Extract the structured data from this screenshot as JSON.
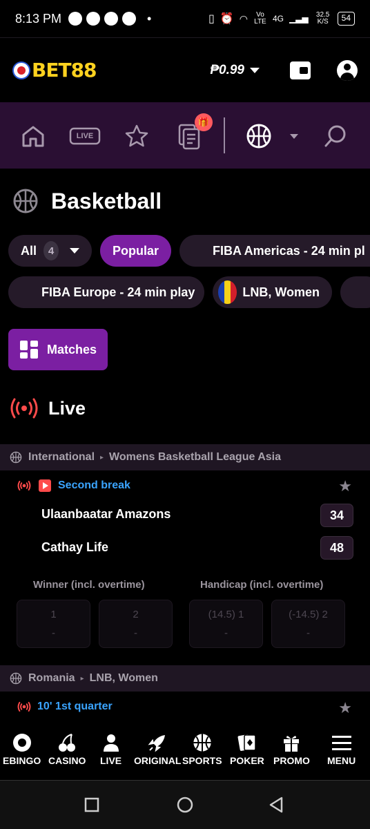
{
  "status_bar": {
    "time": "8:13 PM",
    "network": "Vo LTE",
    "signal": "4G",
    "speed": "32.5 K/S",
    "battery": "54"
  },
  "header": {
    "logo_text": "BET88",
    "balance": "₱0.99"
  },
  "nav": {
    "live_label": "LIVE"
  },
  "page_title": "Basketball",
  "filters": {
    "all_label": "All",
    "all_count": "4",
    "popular_label": "Popular",
    "fiba_americas": "FIBA Americas - 24 min pl",
    "fiba_europe": "FIBA Europe - 24 min play",
    "lnb_women": "LNB, Women"
  },
  "matches_button": "Matches",
  "live_heading": "Live",
  "events": [
    {
      "country": "International",
      "league": "Womens Basketball League Asia",
      "status": "Second break",
      "home_team": "Ulaanbaatar Amazons",
      "away_team": "Cathay Life",
      "home_score": "34",
      "away_score": "48",
      "markets": [
        {
          "label": "Winner (incl. overtime)",
          "outcomes": [
            {
              "name": "1",
              "odds": "-"
            },
            {
              "name": "2",
              "odds": "-"
            }
          ]
        },
        {
          "label": "Handicap (incl. overtime)",
          "outcomes": [
            {
              "name": "(14.5) 1",
              "odds": "-"
            },
            {
              "name": "(-14.5) 2",
              "odds": "-"
            }
          ]
        }
      ]
    },
    {
      "country": "Romania",
      "league": "LNB, Women",
      "status": "10' 1st quarter"
    }
  ],
  "bottom_nav": [
    "EBINGO",
    "CASINO",
    "LIVE",
    "ORIGINAL",
    "SPORTS",
    "POKER",
    "PROMO",
    "MENU"
  ],
  "colors": {
    "accent": "#7b1fa2",
    "nav_band": "#2a0f33",
    "brand_yellow": "#ffd21f",
    "live_red": "#ff4b4b",
    "status_blue": "#3aa4ff"
  }
}
